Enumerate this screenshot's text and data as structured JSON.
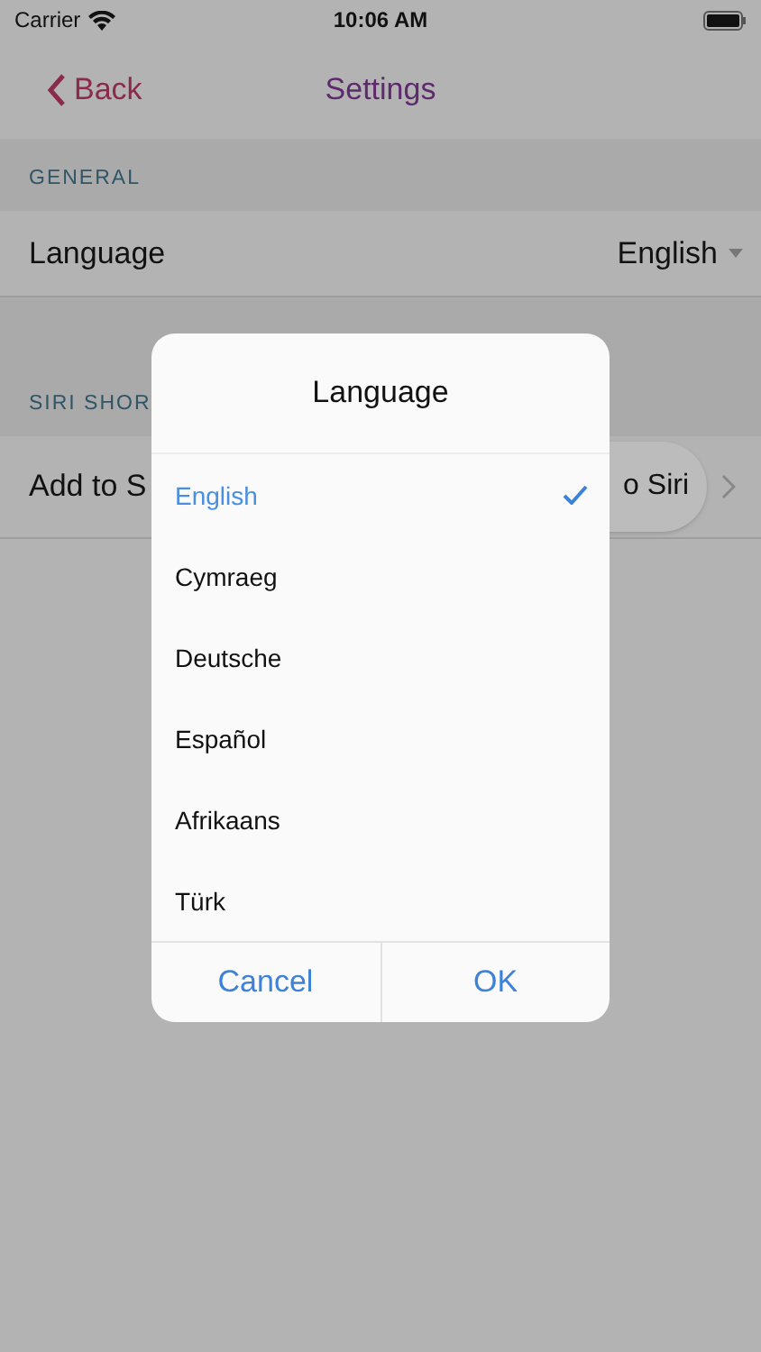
{
  "status_bar": {
    "carrier": "Carrier",
    "time": "10:06 AM"
  },
  "nav": {
    "back": "Back",
    "title": "Settings"
  },
  "sections": [
    {
      "header": "GENERAL",
      "rows": [
        {
          "kind": "dropdown",
          "label": "Language",
          "value": "English"
        }
      ]
    },
    {
      "header": "SIRI SHOR",
      "rows": [
        {
          "kind": "siri",
          "label": "Add to S",
          "value": "o Siri"
        }
      ]
    }
  ],
  "dialog": {
    "title": "Language",
    "options": [
      {
        "label": "English",
        "selected": true
      },
      {
        "label": "Cymraeg",
        "selected": false
      },
      {
        "label": "Deutsche",
        "selected": false
      },
      {
        "label": "Español",
        "selected": false
      },
      {
        "label": "Afrikaans",
        "selected": false
      },
      {
        "label": "Türk",
        "selected": false
      }
    ],
    "buttons": [
      "Cancel",
      "OK"
    ]
  }
}
